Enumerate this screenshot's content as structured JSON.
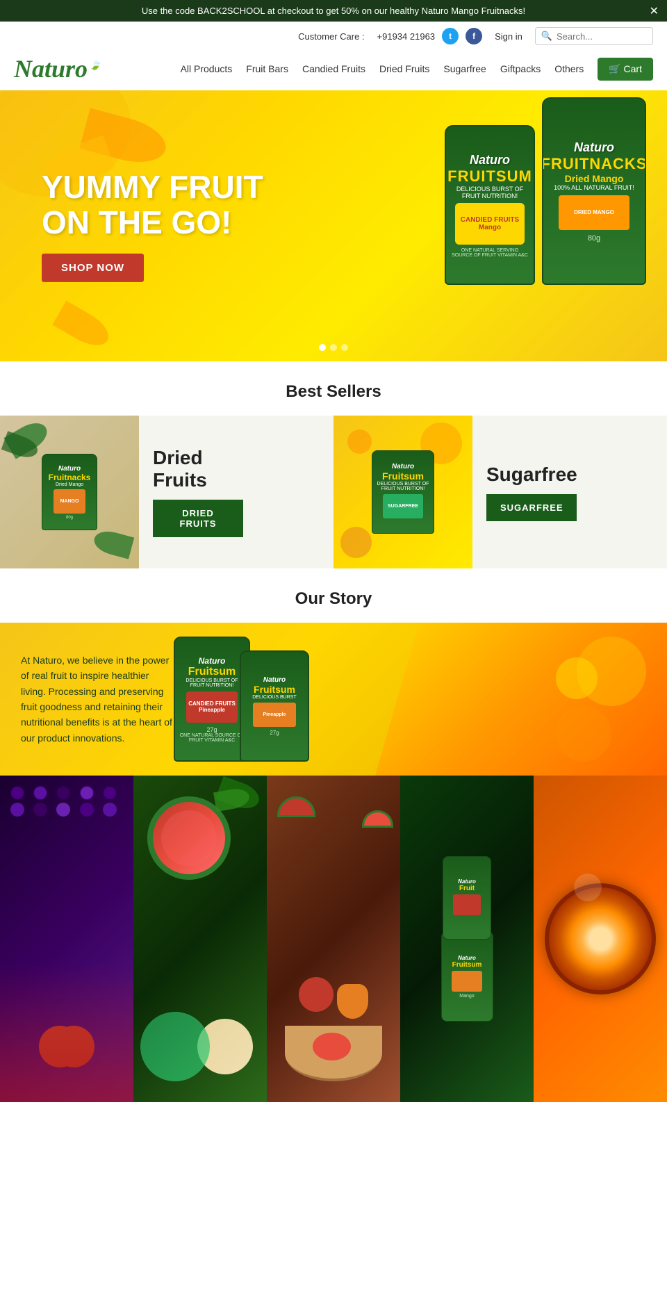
{
  "announcement": {
    "text": "Use the code BACK2SCHOOL at checkout to get 50% on our healthy Naturo Mango Fruitnacks!",
    "close_label": "✕"
  },
  "top_bar": {
    "customer_care_label": "Customer Care :",
    "phone": "+91934 21963",
    "sign_in": "Sign in",
    "search_placeholder": "Search..."
  },
  "logo": {
    "text": "Naturo",
    "leaf": "🍃"
  },
  "nav": {
    "items": [
      {
        "label": "All Products",
        "href": "#"
      },
      {
        "label": "Fruit Bars",
        "href": "#"
      },
      {
        "label": "Candied Fruits",
        "href": "#"
      },
      {
        "label": "Dried Fruits",
        "href": "#"
      },
      {
        "label": "Sugarfree",
        "href": "#"
      },
      {
        "label": "Giftpacks",
        "href": "#"
      },
      {
        "label": "Others",
        "href": "#"
      }
    ],
    "cart_label": "🛒 Cart"
  },
  "hero": {
    "title_line1": "YUMMY FRUIT",
    "title_line2": "ON THE GO!",
    "shop_now": "SHOP NOW",
    "pkg1_brand": "Naturo",
    "pkg1_product": "Fruitsum",
    "pkg1_sub": "DELICIOUS BURST OF FRUIT NUTRITION!",
    "pkg1_content": "CANDIED FRUITS Mango",
    "pkg2_brand": "Naturo",
    "pkg2_product": "Fruitnacks",
    "pkg2_sub": "Dried Mango",
    "pkg2_note": "100% ALL NATURAL FRUIT!",
    "dots": [
      "active",
      "",
      ""
    ]
  },
  "best_sellers": {
    "section_title": "Best Sellers",
    "card1": {
      "title": "Dried\nFruits",
      "btn_label": "DRIED FRUITS"
    },
    "card2": {
      "title": "Sugarfree",
      "btn_label": "SUGARFREE"
    }
  },
  "our_story": {
    "section_title": "Our Story",
    "text": "At Naturo, we believe in the power of real fruit to inspire healthier living. Processing and preserving fruit goodness and retaining their nutritional benefits is at the heart of our product innovations.",
    "pkg1_flavor": "Fruitsum",
    "pkg1_sub": "Pineapple",
    "pkg2_flavor": "Fruitsum",
    "pkg2_sub": "Pineapple"
  },
  "gallery": {
    "items": [
      {
        "bg": "#2a0050",
        "label": "berries"
      },
      {
        "bg": "#1a3a0a",
        "label": "watermelon-guava"
      },
      {
        "bg": "#6b2a0a",
        "label": "mixed-fruits"
      },
      {
        "bg": "#0a3a0a",
        "label": "naturo-products"
      },
      {
        "bg": "#cc5500",
        "label": "orange-slice"
      }
    ]
  }
}
